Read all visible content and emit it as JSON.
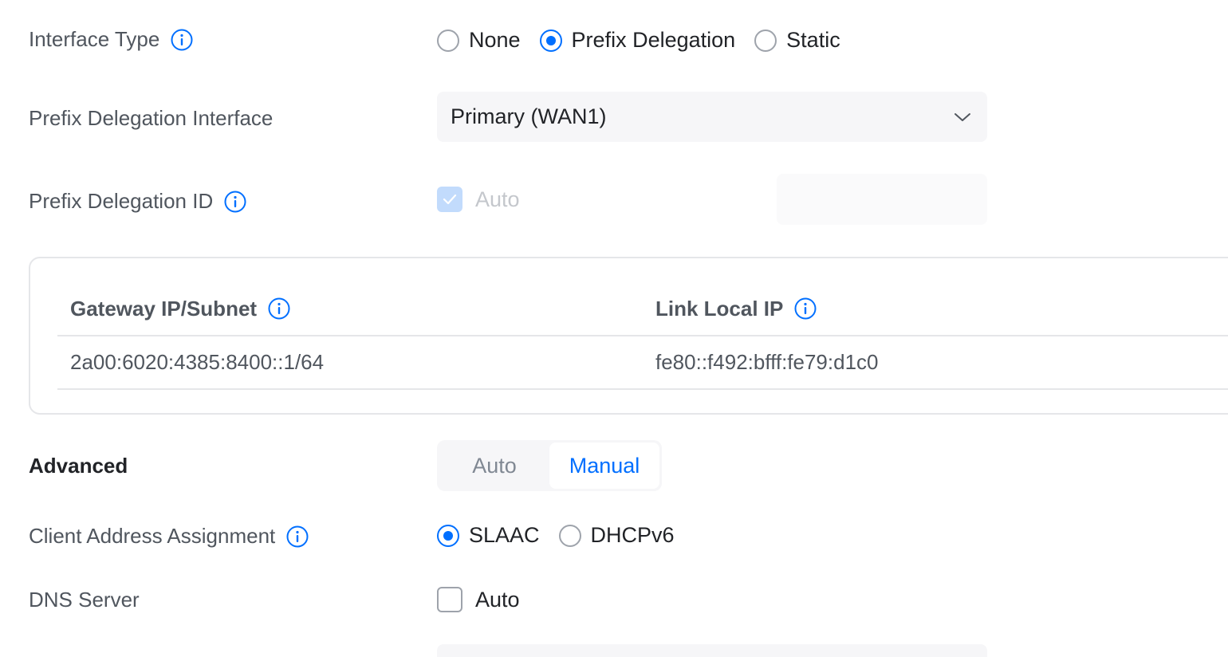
{
  "interface_type": {
    "label": "Interface Type",
    "options": [
      {
        "label": "None",
        "checked": false
      },
      {
        "label": "Prefix Delegation",
        "checked": true
      },
      {
        "label": "Static",
        "checked": false
      }
    ]
  },
  "prefix_delegation_interface": {
    "label": "Prefix Delegation Interface",
    "value": "Primary (WAN1)"
  },
  "prefix_delegation_id": {
    "label": "Prefix Delegation ID",
    "auto_label": "Auto",
    "auto_checked": true,
    "input_value": ""
  },
  "ip_table": {
    "headers": [
      "Gateway IP/Subnet",
      "Link Local IP"
    ],
    "rows": [
      [
        "2a00:6020:4385:8400::1/64",
        "fe80::f492:bfff:fe79:d1c0"
      ]
    ]
  },
  "advanced": {
    "label": "Advanced",
    "segments": [
      {
        "label": "Auto",
        "active": false
      },
      {
        "label": "Manual",
        "active": true
      }
    ]
  },
  "client_address_assignment": {
    "label": "Client Address Assignment",
    "options": [
      {
        "label": "SLAAC",
        "checked": true
      },
      {
        "label": "DHCPv6",
        "checked": false
      }
    ]
  },
  "dns_server": {
    "label": "DNS Server",
    "auto_label": "Auto",
    "auto_checked": false
  },
  "colors": {
    "accent": "#006fff",
    "label": "#50565e",
    "text": "#212327",
    "disabled": "#c4c7cc",
    "field_bg": "#f6f6f8"
  }
}
